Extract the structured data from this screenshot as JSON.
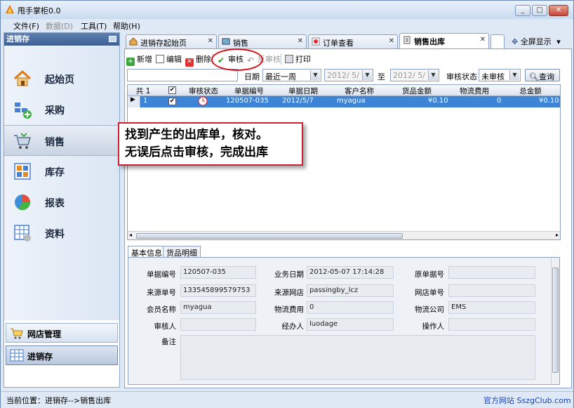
{
  "window": {
    "title": "甩手掌柜0.0"
  },
  "menu": [
    {
      "label": "文件(F)",
      "disabled": false
    },
    {
      "label": "数据(D)",
      "disabled": true
    },
    {
      "label": "工具(T)",
      "disabled": false
    },
    {
      "label": "帮助(H)",
      "disabled": false
    }
  ],
  "left_panel": {
    "header": "进销存",
    "nav": [
      "起始页",
      "采购",
      "销售",
      "库存",
      "报表",
      "资料"
    ],
    "selected_nav": "销售",
    "bottom": [
      "网店管理",
      "进销存"
    ]
  },
  "tabs": [
    {
      "label": "进销存起始页",
      "icon": "home-icon"
    },
    {
      "label": "销售",
      "icon": "sales-icon"
    },
    {
      "label": "订单查看",
      "icon": "order-icon"
    },
    {
      "label": "销售出库",
      "icon": "document-icon"
    }
  ],
  "fullscreen_label": "全屏显示",
  "toolbar": {
    "new": "新增",
    "edit": "编辑",
    "delete": "删除",
    "audit": "审核",
    "unaudit": "反审核",
    "print": "打印"
  },
  "filter": {
    "date_label": "日期",
    "date_range": "最近一周",
    "date_from": "2012/ 5/ 1",
    "to_label": "至",
    "date_to": "2012/ 5/ 7",
    "status_label": "审核状态",
    "status_value": "未审核",
    "query_label": "查询"
  },
  "grid": {
    "headers": [
      "共 1",
      "审核状态",
      "单据编号",
      "单据日期",
      "客户名称",
      "货品金额",
      "物流费用",
      "总金额"
    ],
    "rows": [
      {
        "index": "1",
        "doc_no": "120507-035",
        "date": "2012/5/7",
        "customer": "myagua",
        "goods_amount": "¥0.10",
        "logistics": "0",
        "total": "¥0.10"
      }
    ]
  },
  "callout": {
    "line1": "找到产生的出库单，核对。",
    "line2": "无误后点击审核，完成出库"
  },
  "detail_tabs": [
    "基本信息",
    "货品明细"
  ],
  "detail": {
    "doc_no_label": "单据编号",
    "doc_no": "120507-035",
    "biz_date_label": "业务日期",
    "biz_date": "2012-05-07 17:14:28",
    "orig_doc_label": "原单据号",
    "orig_doc": "",
    "source_no_label": "来源单号",
    "source_no": "133545899579753",
    "source_shop_label": "来源网店",
    "source_shop": "passingby_lcz",
    "shop_no_label": "网店单号",
    "shop_no": "",
    "member_label": "会员名称",
    "member": "myagua",
    "logistics_label": "物流费用",
    "logistics": "0",
    "logistics_co_label": "物流公司",
    "logistics_co": "EMS",
    "auditor_label": "审核人",
    "auditor": "",
    "handler_label": "经办人",
    "handler": "luodage",
    "operator_label": "操作人",
    "operator": "",
    "remark_label": "备注",
    "remark": ""
  },
  "status": {
    "location": "当前位置：进销存-->销售出库",
    "link": "官方网站 SszgClub.com"
  }
}
